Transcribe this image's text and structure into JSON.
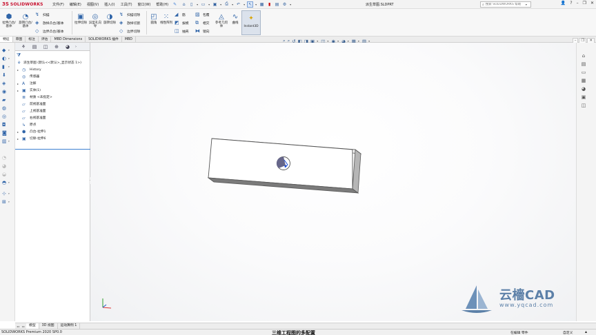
{
  "app": {
    "brand_ds": "3S",
    "brand_name": "SOLIDWORKS",
    "document_title": "派生草图.SLDPRT"
  },
  "menu": [
    "文件(F)",
    "编辑(E)",
    "视图(V)",
    "插入(I)",
    "工具(T)",
    "窗口(W)",
    "帮助(H)"
  ],
  "search": {
    "placeholder": "搜索 SOLIDWORKS 帮助"
  },
  "ribbon": {
    "extrude_boss": "拉伸凸台/基体",
    "revolve_boss": "旋转凸台/基体",
    "sweep_boss": "扫描",
    "loft_boss": "放样凸台/基体",
    "boundary_boss": "边界凸台/基体",
    "extrude_cut": "拉伸切除",
    "hole_wizard": "异型孔向导",
    "revolve_cut": "旋转切除",
    "sweep_cut": "扫描切除",
    "loft_cut": "放样切割",
    "boundary_cut": "边界切除",
    "fillet": "圆角",
    "linear_pattern": "线性阵列",
    "rib": "筋",
    "draft": "拔模",
    "shell": "抽壳",
    "wrap": "包覆",
    "intersect": "相交",
    "mirror": "镜向",
    "reference_geometry": "参考几何体",
    "curves": "曲线",
    "instant3d": "Instant3D"
  },
  "command_tabs": [
    "特征",
    "草图",
    "标注",
    "评估",
    "MBD Dimensions",
    "SOLIDWORKS 插件",
    "MBD"
  ],
  "feature_tree": {
    "root": "派生草图 (默认<<默认>_显示状态 1>)",
    "items": [
      {
        "label": "History",
        "icon": "history-icon",
        "expandable": true
      },
      {
        "label": "传感器",
        "icon": "sensor-icon",
        "expandable": false
      },
      {
        "label": "注解",
        "icon": "annotation-icon",
        "expandable": true
      },
      {
        "label": "实体(1)",
        "icon": "solid-bodies-icon",
        "expandable": true
      },
      {
        "label": "材质 <未指定>",
        "icon": "material-icon",
        "expandable": false
      },
      {
        "label": "前视基准面",
        "icon": "plane-icon",
        "expandable": false
      },
      {
        "label": "上视基准面",
        "icon": "plane-icon",
        "expandable": false
      },
      {
        "label": "右视基准面",
        "icon": "plane-icon",
        "expandable": false
      },
      {
        "label": "原点",
        "icon": "origin-icon",
        "expandable": false
      },
      {
        "label": "凸台-拉伸1",
        "icon": "boss-extrude-icon",
        "expandable": true
      },
      {
        "label": "切除-拉伸6",
        "icon": "cut-extrude-icon",
        "expandable": true
      }
    ]
  },
  "bottom_tabs": [
    "模型",
    "3D 视图",
    "运动算例 1"
  ],
  "watermark": {
    "main": "云檣CAD",
    "url": "www.yqcad.com"
  },
  "status": {
    "version": "SOLIDWORKS Premium 2020 SP0.0",
    "center_text": "三维工程图的多配置",
    "editing": "在编辑 零件",
    "units": "自定义"
  },
  "colors": {
    "brand": "#c8102e",
    "accent": "#2f64a8",
    "rollback": "#3c7fd1",
    "model_face": "#ffffff",
    "model_edge": "#555555",
    "hole_fill": "#6a6a8e"
  }
}
